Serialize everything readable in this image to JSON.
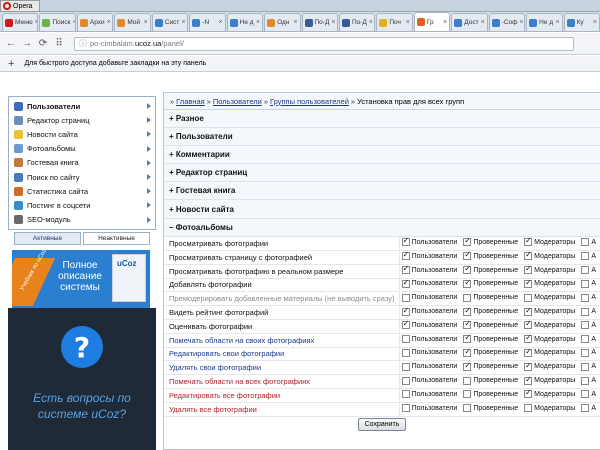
{
  "browser": {
    "menu_label": "Opera",
    "tabs": [
      {
        "title": "Меню",
        "color": "#cc1b1b",
        "active": false
      },
      {
        "title": "Поиск",
        "color": "#6bb34a",
        "active": false
      },
      {
        "title": "Архи",
        "color": "#e08a2a",
        "active": false
      },
      {
        "title": "Мой",
        "color": "#e08a2a",
        "active": false
      },
      {
        "title": "Cист",
        "color": "#3a7fc8",
        "active": false
      },
      {
        "title": "-N",
        "color": "#3a7fc8",
        "active": false
      },
      {
        "title": "Не д",
        "color": "#3a7fc8",
        "active": false
      },
      {
        "title": "Одн",
        "color": "#e08a2a",
        "active": false
      },
      {
        "title": "По-Д",
        "color": "#3b5998",
        "active": false
      },
      {
        "title": "По-Д",
        "color": "#3b5998",
        "active": false
      },
      {
        "title": "Поч",
        "color": "#e0b020",
        "active": false
      },
      {
        "title": "Гр",
        "color": "#e06020",
        "active": true
      },
      {
        "title": "Дост",
        "color": "#3a7fc8",
        "active": false
      },
      {
        "title": "-Соф",
        "color": "#3a7fc8",
        "active": false
      },
      {
        "title": "Не д",
        "color": "#3a7fc8",
        "active": false
      },
      {
        "title": "Ку",
        "color": "#3a7fc8",
        "active": false
      }
    ],
    "url_prefix": "po-cimbalam.",
    "url_domain": "ucoz.ua",
    "url_suffix": "/panel/",
    "bookmark_hint": "Для быстрого доступа добавьте закладки на эту панель"
  },
  "sidebar": {
    "items": [
      {
        "label": "Пользователи",
        "icon_color": "#3a6fc0",
        "bold": true,
        "icon": "users-icon"
      },
      {
        "label": "Редактор страниц",
        "icon_color": "#6a8fb8",
        "bold": false,
        "icon": "pages-icon"
      },
      {
        "label": "Новости сайта",
        "icon_color": "#e8c23a",
        "bold": false,
        "icon": "news-icon"
      },
      {
        "label": "Фотоальбомы",
        "icon_color": "#6a9ad0",
        "bold": false,
        "icon": "photo-icon"
      },
      {
        "label": "Гостевая книга",
        "icon_color": "#c07a3a",
        "bold": false,
        "icon": "guestbook-icon"
      },
      {
        "label": "Поиск по сайту",
        "icon_color": "#4a7ac0",
        "bold": false,
        "icon": "search-icon"
      },
      {
        "label": "Статистика сайта",
        "icon_color": "#d06a2a",
        "bold": false,
        "icon": "stats-icon"
      },
      {
        "label": "Постинг в соцсети",
        "icon_color": "#3a8ad0",
        "bold": false,
        "icon": "share-icon"
      },
      {
        "label": "SEO-модуль",
        "icon_color": "#6a6a6a",
        "bold": false,
        "icon": "seo-icon"
      }
    ],
    "tab_active": "Активные",
    "tab_inactive": "Неактивные"
  },
  "ad1": {
    "ribbon": "Учебник по uCoz",
    "text": "Полное описание системы",
    "box_logo": "uCoz"
  },
  "ad2": {
    "glyph": "?",
    "text": "Есть вопросы по системе uCoz?"
  },
  "main": {
    "breadcrumb": {
      "home": "Главная",
      "users": "Пользователи",
      "groups": "Группы пользователей",
      "current": "Установка прав для всех групп",
      "sep": "»"
    },
    "sections": [
      {
        "label": "+ Разное"
      },
      {
        "label": "+ Пользователи"
      },
      {
        "label": "+ Комментарии"
      },
      {
        "label": "+ Редактор страниц"
      },
      {
        "label": "+ Гостевая книга"
      },
      {
        "label": "+ Новости сайта"
      },
      {
        "label": "– Фотоальбомы"
      }
    ],
    "column_labels": [
      "Пользователи",
      "Проверенные",
      "Модераторы",
      "А"
    ],
    "rows": [
      {
        "label": "Просматривать фотографии",
        "tone": "default",
        "checks": [
          true,
          true,
          true
        ]
      },
      {
        "label": "Просматривать страницу с фотографией",
        "tone": "default",
        "checks": [
          true,
          true,
          true
        ]
      },
      {
        "label": "Просматривать фотографию в реальном размере",
        "tone": "default",
        "checks": [
          true,
          true,
          true
        ]
      },
      {
        "label": "Добавлять фотографии",
        "tone": "default",
        "checks": [
          true,
          true,
          true
        ]
      },
      {
        "label": "Премодерировать добавленные материалы (не выводить сразу)",
        "tone": "gray",
        "checks": [
          false,
          false,
          false
        ]
      },
      {
        "label": "Видеть рейтинг фотографий",
        "tone": "default",
        "checks": [
          true,
          true,
          true
        ]
      },
      {
        "label": "Оценивать фотографии",
        "tone": "default",
        "checks": [
          true,
          true,
          true
        ]
      },
      {
        "label": "Помечать области на своих фотографиях",
        "tone": "blue",
        "checks": [
          false,
          true,
          true
        ]
      },
      {
        "label": "Редактировать свои фотографии",
        "tone": "blue",
        "checks": [
          false,
          true,
          true
        ]
      },
      {
        "label": "Удалять свои фотографии",
        "tone": "blue",
        "checks": [
          false,
          true,
          true
        ]
      },
      {
        "label": "Помечать области на всех фотографиях",
        "tone": "red",
        "checks": [
          false,
          false,
          true
        ]
      },
      {
        "label": "Редактировать все фотографии",
        "tone": "red",
        "checks": [
          false,
          false,
          true
        ]
      },
      {
        "label": "Удалять все фотографии",
        "tone": "red",
        "checks": [
          false,
          false,
          false
        ]
      }
    ],
    "save_label": "Сохранить"
  }
}
